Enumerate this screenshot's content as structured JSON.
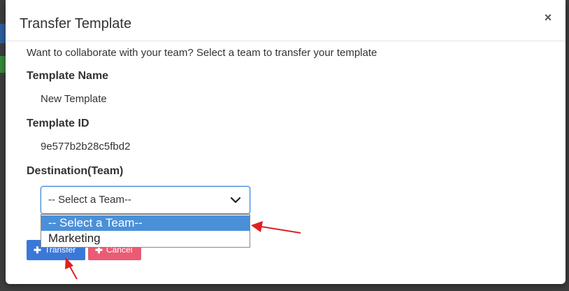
{
  "modal": {
    "title": "Transfer Template",
    "close_glyph": "×",
    "intro": "Want to collaborate with your team? Select a team to transfer your template",
    "template_name_label": "Template Name",
    "template_name_value": "New Template",
    "template_id_label": "Template ID",
    "template_id_value": "9e577b2b28c5fbd2",
    "destination_label": "Destination(Team)",
    "select": {
      "value": "-- Select a Team--",
      "options": [
        "-- Select a Team--",
        "Marketing"
      ],
      "selected_index": 0
    },
    "buttons": {
      "transfer_label": "Transfer",
      "transfer_icon": "plus-icon",
      "cancel_label": "Cancel",
      "cancel_icon": "plus-icon"
    }
  },
  "colors": {
    "primary": "#3a78d8",
    "danger": "#ea5b74",
    "select_focus": "#3c85d5",
    "option_highlight": "#4a90d9",
    "annotation_arrow": "#e02020"
  }
}
